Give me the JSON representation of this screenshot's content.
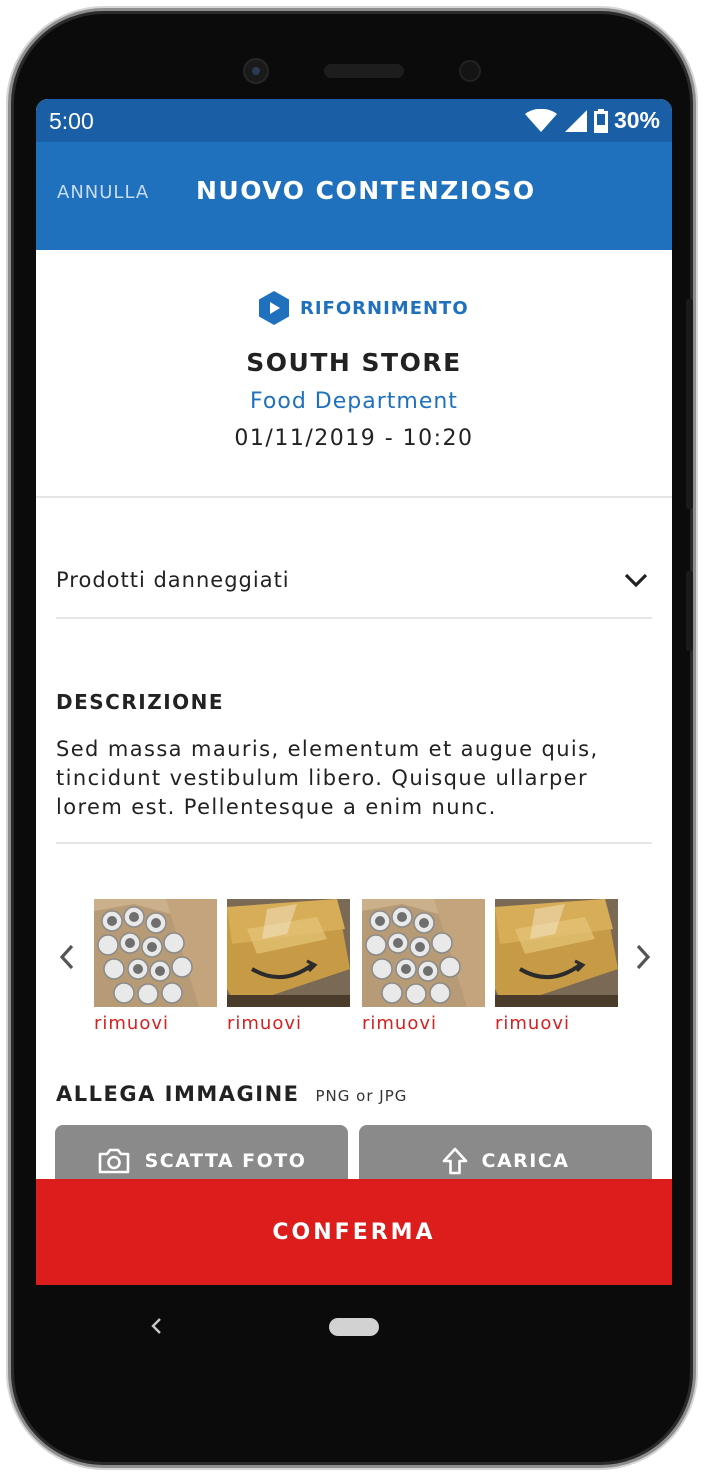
{
  "status_bar": {
    "time": "5:00",
    "battery": "30%"
  },
  "app_bar": {
    "cancel_label": "ANNULLA",
    "title": "NUOVO CONTENZIOSO"
  },
  "header": {
    "category": "RIFORNIMENTO",
    "store": "SOUTH STORE",
    "department": "Food Department",
    "datetime": "01/11/2019 - 10:20"
  },
  "dispute_type": {
    "value": "Prodotti danneggiati"
  },
  "description": {
    "label": "DESCRIZIONE",
    "line1": "Sed massa mauris, elementum et augue quis,",
    "line2": "tincidunt vestibulum libero. Quisque ullarper",
    "line3": "lorem est. Pellentesque a enim nunc."
  },
  "gallery": {
    "items": [
      {
        "image": "mugs-in-box-photo",
        "remove_label": "rimuovi"
      },
      {
        "image": "damaged-box-photo",
        "remove_label": "rimuovi"
      },
      {
        "image": "mugs-in-box-photo",
        "remove_label": "rimuovi"
      },
      {
        "image": "damaged-box-photo",
        "remove_label": "rimuovi"
      }
    ]
  },
  "attach": {
    "title": "ALLEGA IMMAGINE",
    "hint": "PNG or JPG",
    "take_photo_label": "SCATTA FOTO",
    "upload_label": "CARICA"
  },
  "confirm_label": "CONFERMA",
  "colors": {
    "primary": "#1f70bd",
    "status_bar": "#1a5fa6",
    "confirm": "#dd1c1c",
    "remove_text": "#d62121",
    "button_grey": "#8a8a8a"
  }
}
